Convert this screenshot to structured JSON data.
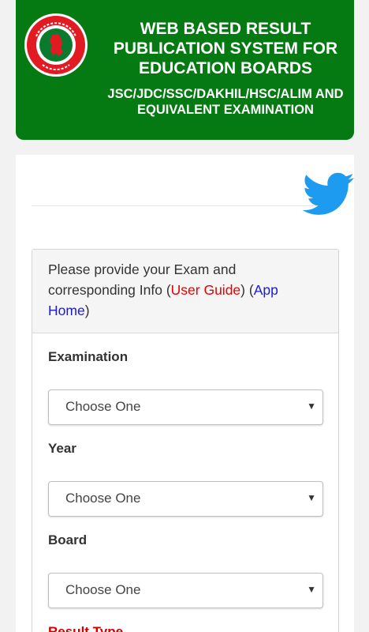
{
  "header": {
    "title_lines": [
      "WEB BASED RESULT",
      "PUBLICATION SYSTEM FOR",
      "EDUCATION BOARDS"
    ],
    "subtitle_lines": [
      "JSC/JDC/SSC/DAKHIL/HSC/ALIM AND",
      "EQUIVALENT EXAMINATION"
    ],
    "logo_icon": "government-seal-icon"
  },
  "social": {
    "icon": "twitter-bird-icon"
  },
  "form": {
    "intro_prefix": "Please provide your Exam and corresponding Info (",
    "user_guide_link": "User Guide",
    "intro_middle": ") (",
    "app_home_link": "App Home",
    "intro_suffix": ")",
    "fields": [
      {
        "label": "Examination",
        "selected": "Choose One"
      },
      {
        "label": "Year",
        "selected": "Choose One"
      },
      {
        "label": "Board",
        "selected": "Choose One"
      }
    ],
    "result_type_label": "Result Type"
  },
  "colors": {
    "header_green": "#067a12",
    "link_red": "#e60000",
    "link_blue": "#1a1adb",
    "twitter_blue": "#1d9bf0"
  }
}
